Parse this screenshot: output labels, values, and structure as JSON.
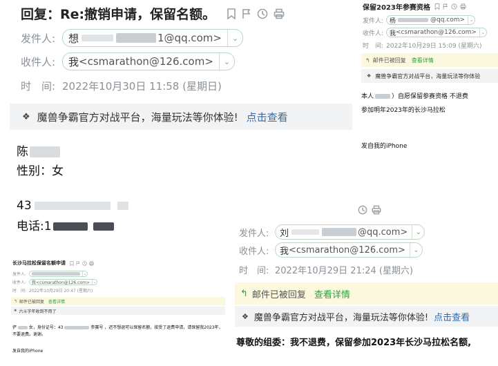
{
  "mail_a": {
    "subject": "回复：Re:撤销申请，保留名额。",
    "from_label": "发件人:",
    "from_name": "想",
    "from_email_suffix": "1@qq.com>",
    "to_label": "收件人:",
    "to_name": "我",
    "to_email": "<csmarathon@126.com>",
    "time_label": "时　间:",
    "time_value": "2022年10月30日 11:58 (星期日)",
    "ad_text": "魔兽争霸官方对战平台，海量玩法等你体验!",
    "ad_link": "点击查看",
    "line_name": "陈",
    "line_gender": "性别：女",
    "line_id": "43",
    "line_phone": "电话:1"
  },
  "mail_b": {
    "subject": "保留2023年参赛资格",
    "from_label": "发件人:",
    "from_name": "杨",
    "from_email_suffix": "@qq.com>",
    "to_label": "收件人:",
    "to_name": "我",
    "to_email": "<csmarathon@126.com>",
    "time_label": "时　间:",
    "time_value": "2022年10月29日 15:09 (星期六)",
    "replied_text": "邮件已被回复",
    "details_link": "查看详情",
    "ad_text": "魔兽争霸官方对战平台，海量玩法等你体验",
    "body_line1_a": "本人",
    "body_line1_b": "）自愿保留参赛资格 不退费",
    "body_line2": "参加明年2023年的长沙马拉松",
    "signature": "发自我的iPhone"
  },
  "mail_c": {
    "subject": "长沙马拉松保留名额申请",
    "from_label": "发件人:",
    "to_label": "收件人:",
    "to_value": "我<csmarathon@126.com>",
    "time_label": "时　间:",
    "time_value": "2022年10月29日 20:47 (星期六)",
    "replied_text": "邮件已被回复",
    "details_link": "查看详情",
    "ad_text": "六斗字年收到不用了",
    "body_part1": "俨",
    "body_part2": "女，身份证号：43",
    "body_part3": "参赛号",
    "body_part4": "，迟不想退可以保留名额，接受了退费申请，请保留我2023年，不要退费。谢谢。",
    "signature": "发自我的iPhone"
  },
  "mail_d": {
    "from_label": "发件人:",
    "from_name": "刘",
    "from_email_suffix": "@qq.com>",
    "to_label": "收件人:",
    "to_name": "我",
    "to_email": "<csmarathon@126.com>",
    "time_label": "时　间:",
    "time_value": "2022年10月29日 21:24 (星期六)",
    "replied_text": "邮件已被回复",
    "details_link": "查看详情",
    "ad_text": "魔兽争霸官方对战平台，海量玩法等你体验!",
    "ad_link": "点击查看",
    "body_line": "尊敬的组委：我不退费，保留参加2023年长沙马拉松名额,"
  },
  "colors": {
    "pill_border": "#b9d9c5",
    "link": "#2f6ab3",
    "reply_green": "#2ea043",
    "yellow_band": "#fbf8de",
    "gray_band": "#f2f3f5"
  }
}
